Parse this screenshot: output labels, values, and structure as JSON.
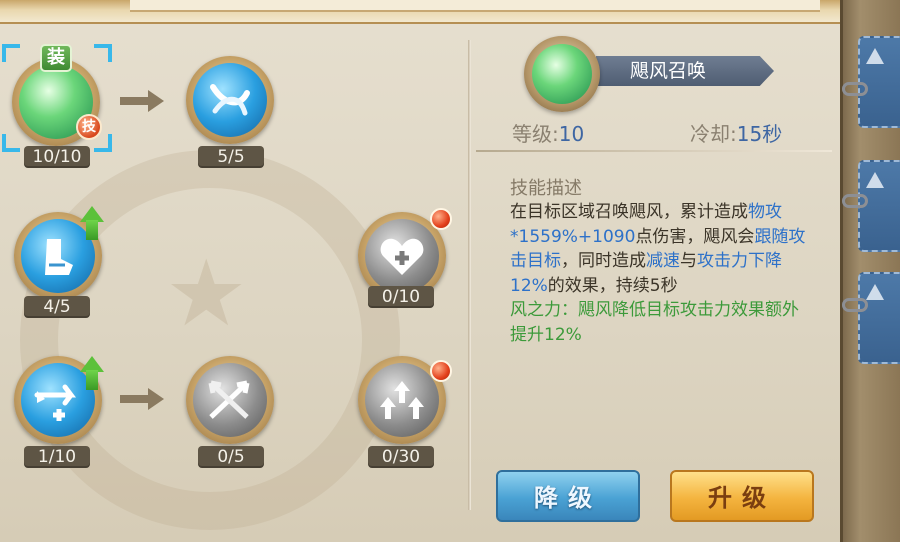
{
  "left_tree": {
    "nodes": [
      {
        "id": "gale_summon",
        "count": "10/10",
        "icon": "green-orb-icon",
        "selected": true,
        "badge_top": "装",
        "badge_bottom": "技"
      },
      {
        "id": "wind_spiral",
        "count": "5/5",
        "icon": "whirlwind-icon"
      },
      {
        "id": "dash_boost",
        "count": "4/5",
        "icon": "boot-icon",
        "upgradeable": true
      },
      {
        "id": "heal_plus",
        "count": "0/10",
        "icon": "heart-plus-icon",
        "new": true
      },
      {
        "id": "arrow_heal",
        "count": "1/10",
        "icon": "winged-arrow-icon",
        "upgradeable": true
      },
      {
        "id": "crossed_blades",
        "count": "0/5",
        "icon": "crossed-arrows-icon"
      },
      {
        "id": "triple_up",
        "count": "0/30",
        "icon": "triple-up-arrows-icon",
        "new": true
      }
    ]
  },
  "detail": {
    "skill_name": "飓风召唤",
    "level_label": "等级:",
    "level_value": "10",
    "cooldown_label": "冷却:",
    "cooldown_value": "15秒",
    "desc_title": "技能描述",
    "desc_parts": {
      "p1": "在目标区域召唤飓风，累计造成",
      "p2": "物攻*1559%+1090",
      "p3": "点伤害，飓风会",
      "p4": "跟随攻击目标",
      "p5": "，同时造成",
      "p6": "减速",
      "p7": "与",
      "p8": "攻击力下降12%",
      "p9": "的效果，持续5秒",
      "p10": "风之力：飓风降低目标攻击力效果额外提升12%"
    }
  },
  "buttons": {
    "downgrade": "降级",
    "upgrade": "升级"
  },
  "colors": {
    "highlight_blue": "#2d71c9",
    "passive_green": "#3c9a3a",
    "count_bg": "#5e5545"
  }
}
